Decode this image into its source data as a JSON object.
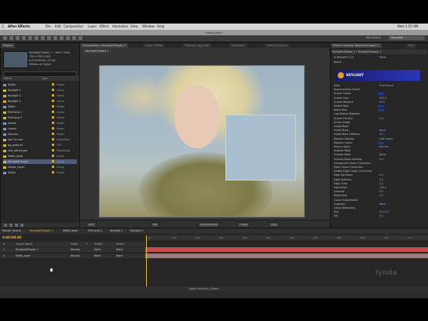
{
  "mac_menu": {
    "app_name": "After Effects",
    "items": [
      "File",
      "Edit",
      "Composition",
      "Layer",
      "Effect",
      "Animation",
      "View",
      "Window",
      "Help"
    ],
    "clock": "Wed 1:55 AM"
  },
  "window_title": "Finding.aep *",
  "workspace": {
    "label": "Workspace",
    "value": "Standard"
  },
  "project": {
    "tab": "Project",
    "info": [
      "Keylight(Shape) 1  · used 1 time",
      "720 x 576 (1.00)",
      "Δ 0:00:05:00, 25 fps",
      "Millions of Colors"
    ],
    "search_placeholder": "",
    "columns": [
      "Name",
      "Type"
    ],
    "rows": [
      {
        "name": "Solids",
        "type": "Folder",
        "folder": true
      },
      {
        "name": "Keylight 1",
        "type": "Comp",
        "folder": false
      },
      {
        "name": "Keylight 2",
        "type": "Comp",
        "folder": false
      },
      {
        "name": "Keylight 3",
        "type": "Comp",
        "folder": false
      },
      {
        "name": "Matte",
        "type": "Folder",
        "folder": true
      },
      {
        "name": "PreComp 1",
        "type": "Comp",
        "folder": false
      },
      {
        "name": "PreComp 2",
        "type": "Comp",
        "folder": false
      },
      {
        "name": "Assets",
        "type": "Folder",
        "folder": true
      },
      {
        "name": "Layers",
        "type": "Folder",
        "folder": true
      },
      {
        "name": "Sources",
        "type": "Folder",
        "folder": true
      },
      {
        "name": "hair_fx.mov",
        "type": "QuickTime",
        "folder": false
      },
      {
        "name": "bg_plate.tif",
        "type": "TIFF",
        "folder": false
      },
      {
        "name": "skin_detail.psd",
        "type": "Photoshop",
        "folder": false
      },
      {
        "name": "Matte_layer",
        "type": "Comp",
        "folder": false
      },
      {
        "name": "Keylight(Shape)",
        "type": "Comp",
        "folder": false,
        "selected": true
      },
      {
        "name": "Shape_Layer",
        "type": "Comp",
        "folder": false
      },
      {
        "name": "Solids",
        "type": "Folder",
        "folder": true
      }
    ]
  },
  "viewer": {
    "tabs": [
      "Composition: Keylight(Shape) 1",
      "Layer: Matte",
      "Footage: bg_plate",
      "Flowchart",
      "Effect Controls"
    ],
    "sub_tab": "Keylight(Shape) 1",
    "controls": [
      "50%",
      "Full",
      "Active Camera",
      "1 View",
      "+0.0"
    ]
  },
  "effects": {
    "tabs": [
      "Effect Controls: Keylight(Shape) 1",
      "Info"
    ],
    "header": "Keylight(Shape) 1 • Keylight(Shape) 1",
    "brand": "KEYLIGHT",
    "lines": [
      {
        "label": "fx  Keylight (1.2)",
        "value": "Reset"
      },
      {
        "label": "    About...",
        "value": ""
      },
      {
        "label": "View",
        "value": "Final Result"
      },
      {
        "label": "    Unpremultiply Result",
        "value": ""
      },
      {
        "label": "    Screen Colour",
        "value": "",
        "swatch": true
      },
      {
        "label": "    Screen Gain",
        "value": "100.0"
      },
      {
        "label": "    Screen Balance",
        "value": "50.0"
      },
      {
        "label": "    Despill Bias",
        "value": "",
        "swatch": true
      },
      {
        "label": "    Alpha Bias",
        "value": "",
        "swatch": true
      },
      {
        "label": "    Lock Biases Together",
        "value": ""
      },
      {
        "label": "    Screen Pre-blur",
        "value": "0.0"
      },
      {
        "label": "    Screen Matte",
        "value": ""
      },
      {
        "label": "    Inside Mask",
        "value": ""
      },
      {
        "label": "        Inside Mask",
        "value": "None"
      },
      {
        "label": "        Inside Mask Softness",
        "value": "0.0"
      },
      {
        "label": "    Replace Method",
        "value": "Soft Colour"
      },
      {
        "label": "    Replace Colour",
        "value": "",
        "swatch": true
      },
      {
        "label": "    Source Alpha",
        "value": "Normal"
      },
      {
        "label": "    Outside Mask",
        "value": ""
      },
      {
        "label": "        Outside Mask",
        "value": "None"
      },
      {
        "label": "        Outside Mask Softness",
        "value": "0.0"
      },
      {
        "label": "    Foreground Colour Correction",
        "value": ""
      },
      {
        "label": "    Edge Colour Correction",
        "value": ""
      },
      {
        "label": "        Enable Edge Colour Correction",
        "value": ""
      },
      {
        "label": "        Edge Hardness",
        "value": "0.0"
      },
      {
        "label": "        Edge Softness",
        "value": "0.0"
      },
      {
        "label": "        Edge Grow",
        "value": "0.0"
      },
      {
        "label": "        Saturation",
        "value": "100.0"
      },
      {
        "label": "        Contrast",
        "value": "0.0"
      },
      {
        "label": "        Brightness",
        "value": "0.0"
      },
      {
        "label": "        Colour Suppression",
        "value": ""
      },
      {
        "label": "            Suppress",
        "value": "None"
      },
      {
        "label": "        Colour Balancing",
        "value": ""
      },
      {
        "label": "            Hue",
        "value": "0x+0.0°"
      },
      {
        "label": "            Sat",
        "value": "0.0"
      }
    ]
  },
  "timeline": {
    "tabs": [
      "Render Queue",
      "Keylight(Shape) 1",
      "Matte_layer",
      "PreComp 1",
      "Keylight 1",
      "Keylight 2"
    ],
    "time": "0:00:00:00",
    "ruler": [
      "0s",
      "01s",
      "02s",
      "03s",
      "04s",
      "05s",
      "06s",
      "07s",
      "08s",
      "09s",
      "10s",
      "11s"
    ],
    "columns": [
      "#",
      "Source Name",
      "Mode",
      "T",
      "TrkMat",
      "Parent"
    ],
    "layers": [
      {
        "num": "1",
        "name": "Keylight(Shape) 1",
        "mode": "Normal",
        "trkmat": "None",
        "parent": "None"
      },
      {
        "num": "2",
        "name": "Matte_layer",
        "mode": "Normal",
        "trkmat": "None",
        "parent": "None"
      }
    ],
    "footer": "Toggle Switches / Modes"
  },
  "colors": {
    "accent": "#e0b43a",
    "layer1": "#c84b4b",
    "layer2": "#9b7c7c",
    "selection": "#4e5a78"
  },
  "watermark": "lynda"
}
